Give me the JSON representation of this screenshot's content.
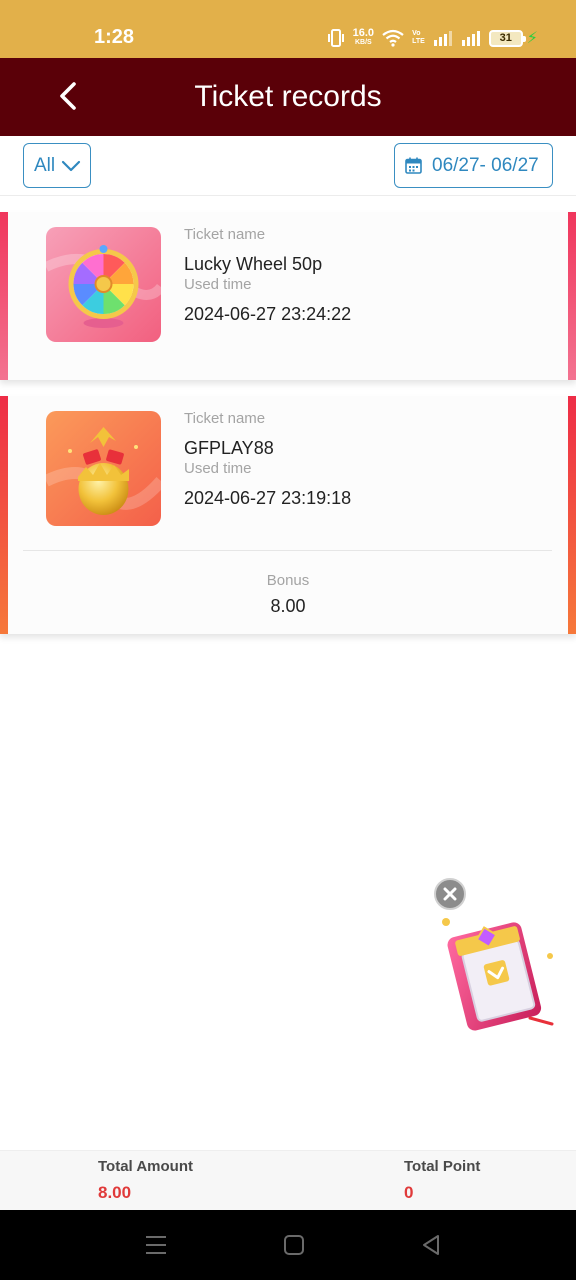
{
  "status_bar": {
    "time": "1:28",
    "net_speed_value": "16.0",
    "net_speed_unit": "KB/S",
    "volte_top": "Vo",
    "volte_bottom": "LTE",
    "battery_level": "31",
    "icons": [
      "vibrate-icon",
      "wifi-icon",
      "signal-icon",
      "signal-icon",
      "battery-icon",
      "charging-icon"
    ]
  },
  "header": {
    "title": "Ticket records",
    "back_icon": "chevron-left-icon"
  },
  "filters": {
    "type_selected": "All",
    "date_range": "06/27- 06/27",
    "accent_color": "#2f88bf"
  },
  "records": [
    {
      "ticket_name_label": "Ticket name",
      "ticket_name": "Lucky Wheel 50p",
      "used_time_label": "Used time",
      "used_time": "2024-06-27 23:24:22",
      "thumbnail": "lucky-wheel-icon"
    },
    {
      "ticket_name_label": "Ticket name",
      "ticket_name": "GFPLAY88",
      "used_time_label": "Used time",
      "used_time": "2024-06-27 23:19:18",
      "thumbnail": "golden-egg-icon",
      "bonus_label": "Bonus",
      "bonus": "8.00"
    }
  ],
  "totals": {
    "amount_label": "Total Amount",
    "amount": "8.00",
    "point_label": "Total Point",
    "point": "0",
    "value_color": "#e03a3a"
  },
  "colors": {
    "status_bar": "#e2b04a",
    "header": "#5a0008"
  }
}
